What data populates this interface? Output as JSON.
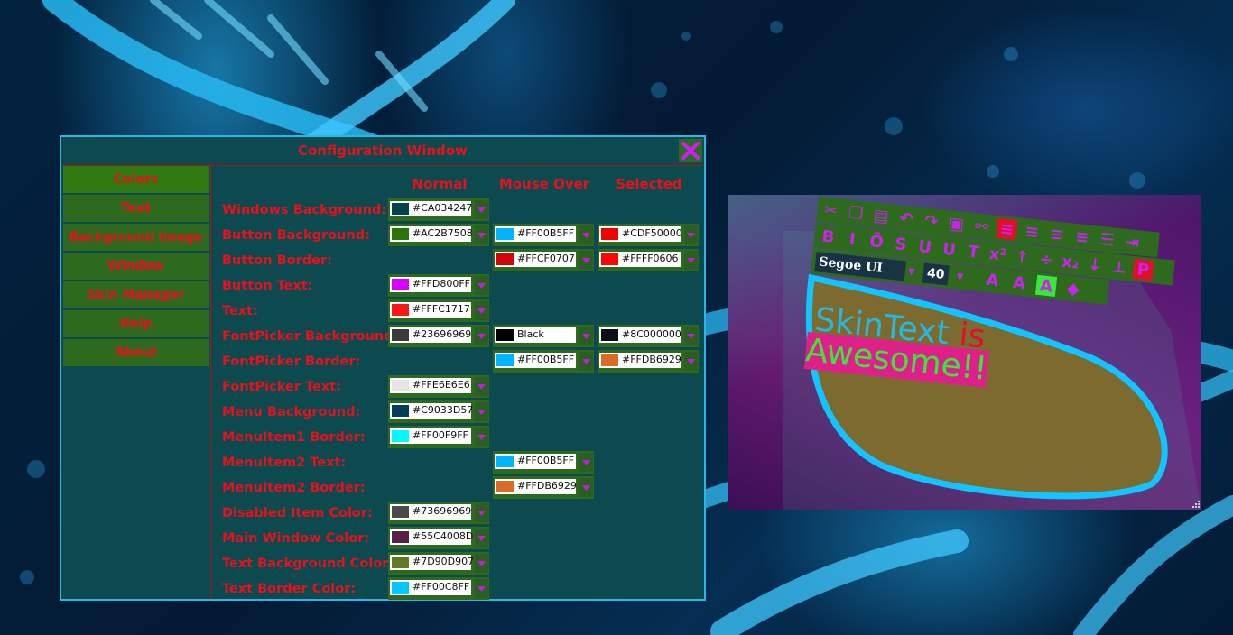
{
  "window": {
    "title": "Configuration Window",
    "close_icon": "x-icon",
    "accent_color": "#e8101a",
    "border_color": "#2ab6e6",
    "background_color": "#0c4a4f"
  },
  "sidebar": {
    "items": [
      {
        "label": "Colors",
        "active": true
      },
      {
        "label": "Text"
      },
      {
        "label": "Background Image"
      },
      {
        "label": "Window"
      },
      {
        "label": "Skin Manager"
      },
      {
        "label": "Help"
      },
      {
        "label": "About"
      }
    ]
  },
  "columns": {
    "normal": "Normal",
    "mouse_over": "Mouse Over",
    "selected": "Selected"
  },
  "rows": [
    {
      "label": "Windows Background:",
      "normal": {
        "value": "#CA034247",
        "color": "#034247"
      }
    },
    {
      "label": "Button Background:",
      "normal": {
        "value": "#AC2B7508",
        "color": "#2B7508"
      },
      "mouse_over": {
        "value": "#FF00B5FF",
        "color": "#00B5FF"
      },
      "selected": {
        "value": "#CDF50000",
        "color": "#F50000"
      }
    },
    {
      "label": "Button Border:",
      "mouse_over": {
        "value": "#FFCF0707",
        "color": "#CF0707"
      },
      "selected": {
        "value": "#FFFF0606",
        "color": "#FF0606"
      }
    },
    {
      "label": "Button Text:",
      "normal": {
        "value": "#FFD800FF",
        "color": "#D800FF"
      }
    },
    {
      "label": "Text:",
      "normal": {
        "value": "#FFFC1717",
        "color": "#FC1717"
      }
    },
    {
      "label": "FontPicker Background:",
      "normal": {
        "value": "#23696969",
        "color": "#3a3a3a"
      },
      "mouse_over": {
        "value": "Black",
        "color": "#000000"
      },
      "selected": {
        "value": "#8C000000",
        "color": "#0d0d1a"
      }
    },
    {
      "label": "FontPicker Border:",
      "mouse_over": {
        "value": "#FF00B5FF",
        "color": "#00B5FF"
      },
      "selected": {
        "value": "#FFDB6929",
        "color": "#DB6929"
      }
    },
    {
      "label": "FontPicker Text:",
      "normal": {
        "value": "#FFE6E6E6",
        "color": "#E6E6E6"
      }
    },
    {
      "label": "Menu Background:",
      "normal": {
        "value": "#C9033D57",
        "color": "#033D57"
      }
    },
    {
      "label": "MenuItem1 Border:",
      "normal": {
        "value": "#FF00F9FF",
        "color": "#00F9FF"
      }
    },
    {
      "label": "MenuItem2 Text:",
      "mouse_over": {
        "value": "#FF00B5FF",
        "color": "#00B5FF"
      }
    },
    {
      "label": "MenuItem2 Border:",
      "mouse_over": {
        "value": "#FFDB6929",
        "color": "#DB6929"
      }
    },
    {
      "label": "Disabled Item Color:",
      "normal": {
        "value": "#73696969",
        "color": "#4a4a4a"
      }
    },
    {
      "label": "Main Window Color:",
      "normal": {
        "value": "#55C4008D",
        "color": "#5a1f4d"
      }
    },
    {
      "label": "Text Background Color:",
      "normal": {
        "value": "#7D90D907",
        "color": "#5f7a20"
      }
    },
    {
      "label": "Text Border Color:",
      "normal": {
        "value": "#FF00C8FF",
        "color": "#00C8FF"
      }
    }
  ],
  "preview": {
    "toolbar": {
      "font_name": "Segoe UI",
      "font_size": "40",
      "row1_icons": [
        "cut-icon",
        "copy-icon",
        "paste-icon",
        "undo-icon",
        "redo-icon",
        "image-icon",
        "link-icon",
        "align-left-icon",
        "align-center-icon",
        "align-right-icon",
        "justify-icon",
        "list-icon",
        "indent-icon"
      ],
      "row2_icons": [
        "bold-icon",
        "italic-icon",
        "overline-icon",
        "strikethrough-icon",
        "underline-icon",
        "double-underline-icon",
        "text-up-icon",
        "superscript-icon",
        "baseline-up-icon",
        "baseline-center-icon",
        "subscript-icon",
        "baseline-down-icon",
        "baseline-bottom-icon",
        "paragraph-icon"
      ],
      "row3_icons": [
        "grow-font-icon",
        "shrink-font-icon",
        "font-color-icon",
        "highlight-color-icon"
      ]
    },
    "text": {
      "word1": "SkinText",
      "word2": "is",
      "word3": "Awesome!!",
      "word1_color": "#27b8e0",
      "word2_color": "#e0102a",
      "word3_color": "#39e63a",
      "word3_highlight": "#e0208a"
    }
  }
}
